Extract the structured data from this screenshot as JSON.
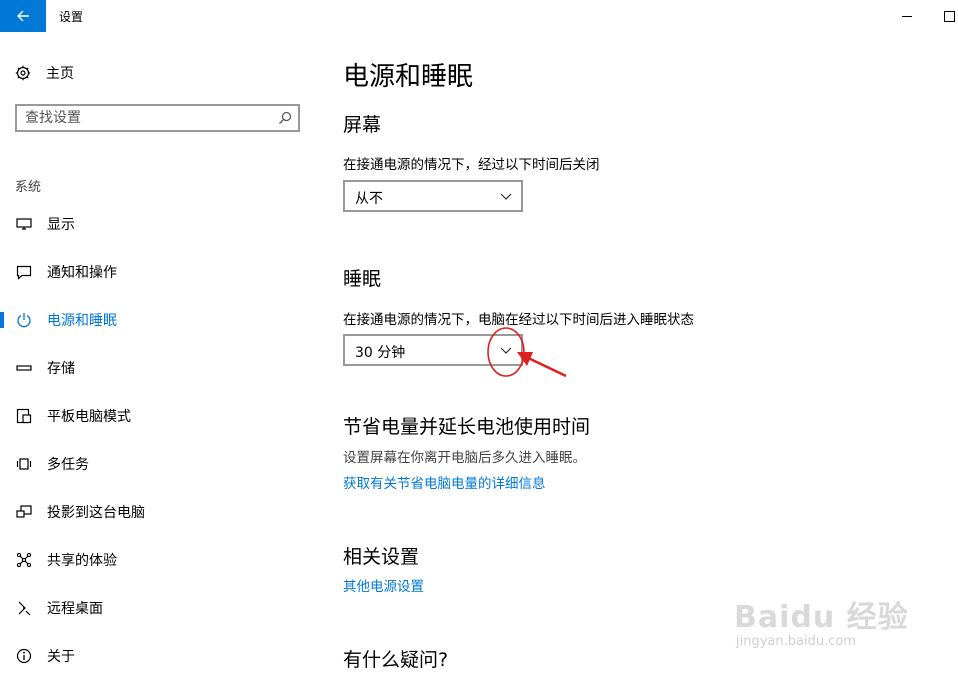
{
  "window": {
    "title": "设置",
    "accent": "#0078d7"
  },
  "sidebar": {
    "home_label": "主页",
    "search_placeholder": "查找设置",
    "section_label": "系统",
    "items": [
      {
        "label": "显示",
        "icon": "monitor-icon"
      },
      {
        "label": "通知和操作",
        "icon": "notification-icon"
      },
      {
        "label": "电源和睡眠",
        "icon": "power-icon",
        "active": true
      },
      {
        "label": "存储",
        "icon": "storage-icon"
      },
      {
        "label": "平板电脑模式",
        "icon": "tablet-mode-icon"
      },
      {
        "label": "多任务",
        "icon": "multitasking-icon"
      },
      {
        "label": "投影到这台电脑",
        "icon": "project-icon"
      },
      {
        "label": "共享的体验",
        "icon": "shared-experiences-icon"
      },
      {
        "label": "远程桌面",
        "icon": "remote-desktop-icon"
      },
      {
        "label": "关于",
        "icon": "info-icon"
      }
    ]
  },
  "main": {
    "title": "电源和睡眠",
    "screen": {
      "heading": "屏幕",
      "description": "在接通电源的情况下，经过以下时间后关闭",
      "value": "从不"
    },
    "sleep": {
      "heading": "睡眠",
      "description": "在接通电源的情况下，电脑在经过以下时间后进入睡眠状态",
      "value": "30 分钟"
    },
    "battery": {
      "heading": "节省电量并延长电池使用时间",
      "description": "设置屏幕在你离开电脑后多久进入睡眠。",
      "link": "获取有关节省电脑电量的详细信息"
    },
    "related": {
      "heading": "相关设置",
      "link": "其他电源设置"
    },
    "questions": {
      "heading": "有什么疑问?"
    }
  },
  "watermark": {
    "brand": "Baidu 经验",
    "url": "jingyan.baidu.com"
  }
}
